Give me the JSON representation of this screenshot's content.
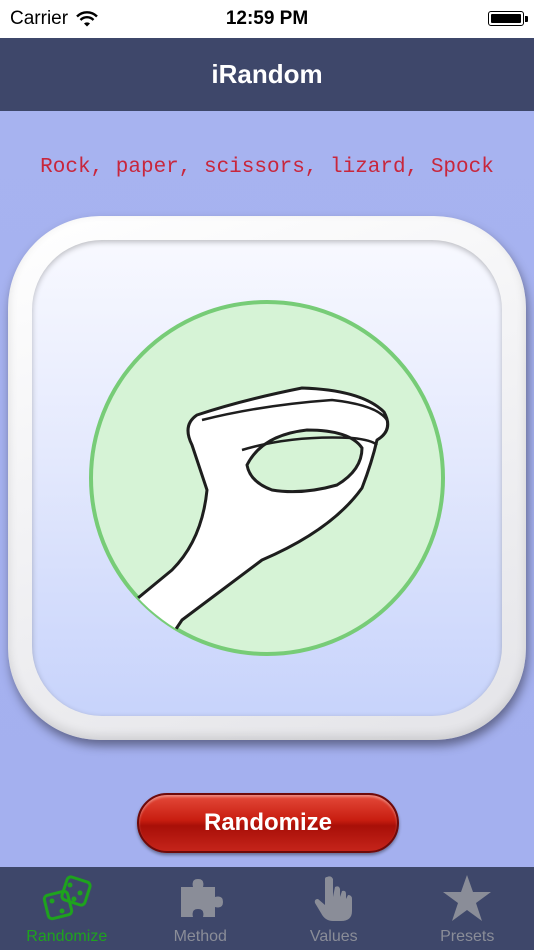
{
  "status": {
    "carrier": "Carrier",
    "time": "12:59 PM"
  },
  "nav": {
    "title": "iRandom"
  },
  "main": {
    "subtitle": "Rock, paper, scissors, lizard, Spock",
    "result_icon": "lizard-hand-icon",
    "button_label": "Randomize"
  },
  "tabs": [
    {
      "label": "Randomize",
      "icon": "dice-icon",
      "active": true
    },
    {
      "label": "Method",
      "icon": "puzzle-icon",
      "active": false
    },
    {
      "label": "Values",
      "icon": "pointing-hand-icon",
      "active": false
    },
    {
      "label": "Presets",
      "icon": "star-icon",
      "active": false
    }
  ],
  "colors": {
    "nav": "#3e476a",
    "background": "#a9b4f0",
    "accent_green": "#1ea31e",
    "subtitle": "#c8263c",
    "button": "#c81d10",
    "circle": "#d6f3d6"
  }
}
